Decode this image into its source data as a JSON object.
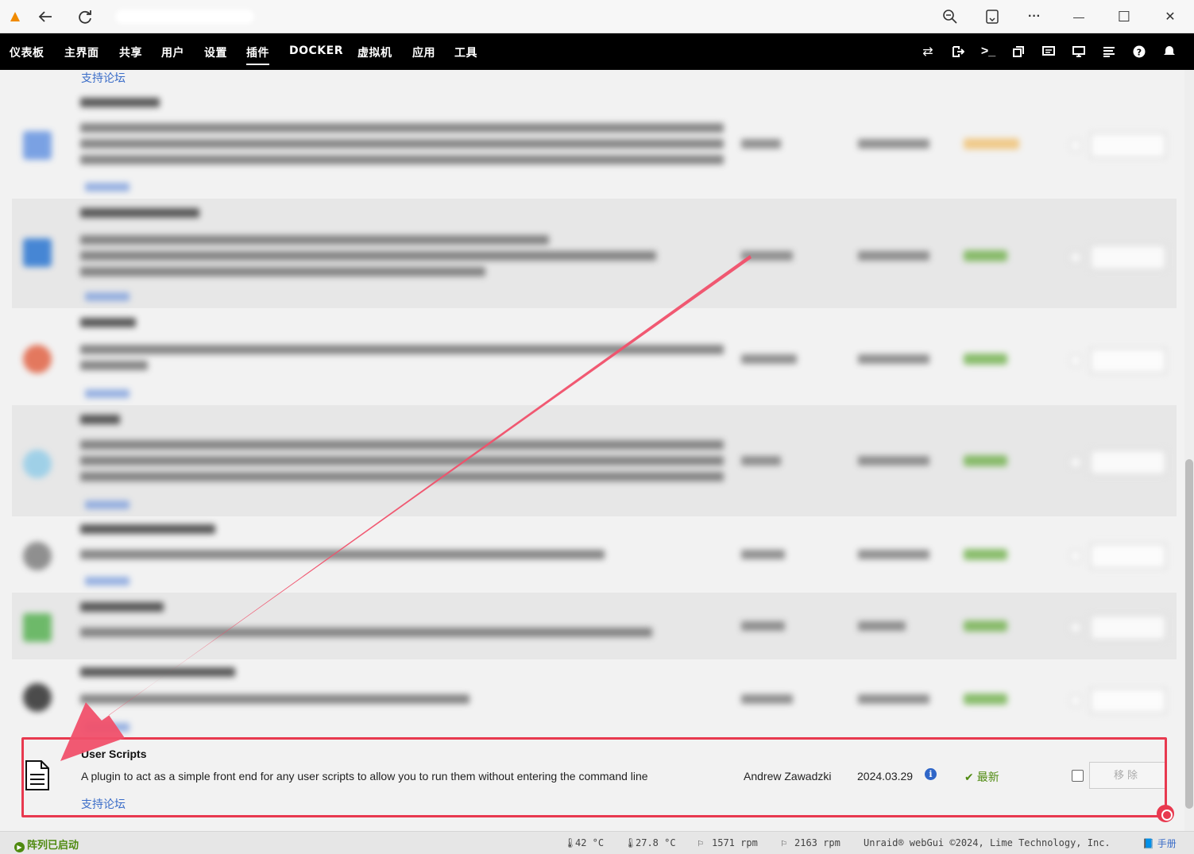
{
  "browser": {
    "back_icon": "arrow-left-icon",
    "reload_icon": "refresh-icon",
    "zoom_icon": "zoom-icon",
    "reader_icon": "reader-icon",
    "menu_label": "···",
    "minimize_label": "—",
    "maximize_label": "☐",
    "close_label": "✕"
  },
  "nav": {
    "tabs": [
      {
        "label": "仪表板"
      },
      {
        "label": "主界面"
      },
      {
        "label": "共享"
      },
      {
        "label": "用户"
      },
      {
        "label": "设置"
      },
      {
        "label": "插件",
        "active": true
      },
      {
        "label": "DOCKER"
      },
      {
        "label": "虚拟机"
      },
      {
        "label": "应用"
      },
      {
        "label": "工具"
      }
    ],
    "tool_icons": [
      "swap-icon",
      "logout-icon",
      "terminal-icon",
      "windows-icon",
      "feedback-icon",
      "display-icon",
      "log-icon",
      "help-icon",
      "bell-icon"
    ]
  },
  "top_link": "支持论坛",
  "featured": {
    "name": "User Scripts",
    "description": "A plugin to act as a simple front end for any user scripts to allow you to run them without entering the command line",
    "support_link": "支持论坛",
    "author": "Andrew Zawadzki",
    "version": "2024.03.29",
    "info_label": "i",
    "status": "最新",
    "remove_label": "移除"
  },
  "footer": {
    "array_status": "阵列已启动",
    "temp1": "42 °C",
    "temp2": "27.8 °C",
    "fan1": "1571 rpm",
    "fan2": "2163 rpm",
    "copyright": "Unraid® webGui ©2024, Lime Technology, Inc.",
    "manual": "手册"
  },
  "colors": {
    "accent": "#e8394f",
    "link": "#3b6dc8",
    "status_ok": "#4f8a10",
    "nav_bg": "#000000"
  }
}
